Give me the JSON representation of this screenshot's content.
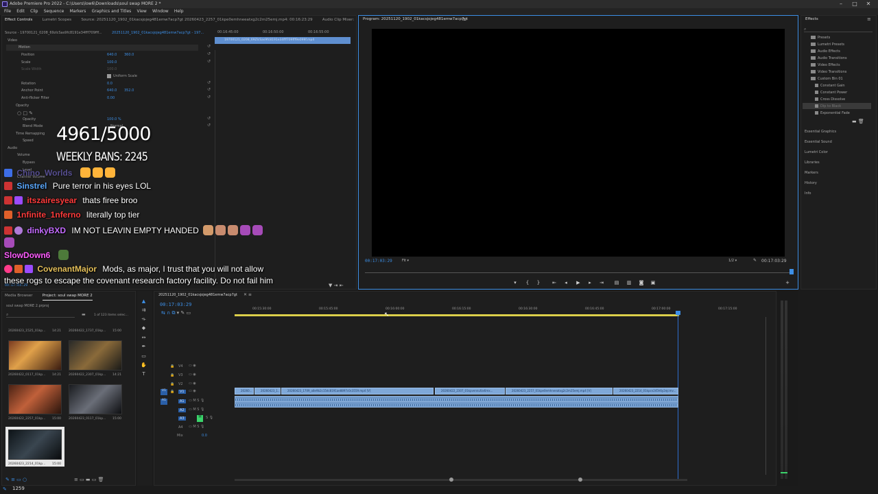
{
  "window": {
    "title": "Adobe Premiere Pro 2022 - C:\\Users\\low6\\Downloads\\soul swap MORE 2 *",
    "controls": [
      "–",
      "□",
      "✕"
    ]
  },
  "menu": [
    "File",
    "Edit",
    "Clip",
    "Sequence",
    "Markers",
    "Graphics and Titles",
    "View",
    "Window",
    "Help"
  ],
  "source_panel": {
    "tabs": [
      "Effect Controls",
      "Lumetri Scopes",
      "Source: 20251120_1902_01kacsjojeg481emw7acp7gt 20260423_2257_01kpe0emhneeatxg2c2m25emj.mp4: 00:16:23:29",
      "Audio Clip Mixer: 2025"
    ],
    "source_path": "Source - 19700121_0208_69zlcSas9fc8191e34fff709fff...",
    "sequence_path": "20251120_1902_01kacsjojeg481emw7acp7gt - 197...",
    "ruler_times": [
      "00:16:45:00",
      "00:16:50:00",
      "00:16:55:00"
    ],
    "clip_label": "19700121_0208_69ZlcSas9fc8191e34fff709fff9e099f.mp4",
    "sections": {
      "video": "Video",
      "motion": "Motion",
      "position": "Position",
      "position_x": "640.0",
      "position_y": "360.0",
      "scale": "Scale",
      "scale_val": "100.0",
      "scale_width": "Scale Width",
      "scale_width_val": "100.0",
      "uniform_scale": "Uniform Scale",
      "rotation": "Rotation",
      "rotation_val": "0.0",
      "anchor": "Anchor Point",
      "anchor_x": "640.0",
      "anchor_y": "352.0",
      "anti_flicker": "Anti-flicker Filter",
      "anti_flicker_val": "0.00",
      "opacity_section": "Opacity",
      "opacity": "Opacity",
      "opacity_val": "100.0 %",
      "blend_mode": "Blend Mode",
      "blend_mode_val": "Normal",
      "time_remap": "Time Remapping",
      "speed": "Speed",
      "audio": "Audio",
      "volume": "Volume",
      "bypass": "Bypass",
      "level": "Level",
      "channel_volume": "Channel Volume"
    },
    "footer_time": "00:17:03:29"
  },
  "overlay": {
    "counter": "4961/5000",
    "weekly_bans": "WEEKLY BANS: 2245",
    "chat": [
      {
        "user": "Chino_Worlds",
        "text": "",
        "user_color": "#8d7cff",
        "emotes": 3
      },
      {
        "user": "Sinstrel",
        "text": "Pure terror in his eyes LOL",
        "user_color": "#5aa8ff",
        "emotes": 0
      },
      {
        "user": "itszairesyear",
        "text": "thats firee broo",
        "user_color": "#ff3b3b",
        "emotes": 0
      },
      {
        "user": "1nfinite_1nferno",
        "text": "literally top tier",
        "user_color": "#ff3b3b",
        "emotes": 0
      },
      {
        "user": "dinkyBXD",
        "text": "IM NOT LEAVIN EMPTY HANDED",
        "user_color": "#c46bff",
        "emotes": 5
      },
      {
        "user": "SlowDown6",
        "text": "",
        "user_color": "#ff5cff",
        "emotes": 1
      },
      {
        "user": "CovenantMajor",
        "text": "Mods, as major, I trust that you will not allow",
        "user_color": "#e6c15a",
        "emotes": 0
      },
      {
        "user": "",
        "text": "these rogs to escape the covenant research factory facility. Do not fail him",
        "user_color": "#ffffff",
        "emotes": 0
      }
    ]
  },
  "program_panel": {
    "title": "Program: 20251120_1902_01kacsjojeg481emw7acp7gt",
    "timecode": "00:17:03:29",
    "fit": "Fit",
    "resolution": "1/2",
    "duration": "00:17:03:29"
  },
  "effects_panel": {
    "title": "Effects",
    "items": [
      {
        "label": "Presets",
        "indent": 0
      },
      {
        "label": "Lumetri Presets",
        "indent": 0
      },
      {
        "label": "Audio Effects",
        "indent": 0
      },
      {
        "label": "Audio Transitions",
        "indent": 0
      },
      {
        "label": "Video Effects",
        "indent": 0
      },
      {
        "label": "Video Transitions",
        "indent": 0
      },
      {
        "label": "Custom Bin 01",
        "indent": 0
      },
      {
        "label": "Constant Gain",
        "indent": 1
      },
      {
        "label": "Constant Power",
        "indent": 1
      },
      {
        "label": "Cross Dissolve",
        "indent": 1
      },
      {
        "label": "Dip to Black",
        "indent": 1
      },
      {
        "label": "Exponential Fade",
        "indent": 1
      }
    ],
    "side": [
      "Essential Graphics",
      "Essential Sound",
      "Lumetri Color",
      "Libraries",
      "Markers",
      "History",
      "Info"
    ]
  },
  "project_panel": {
    "tabs": [
      "Media Browser",
      "Project: soul swap MORE 2"
    ],
    "project_file": "soul swap MORE 2.prproj",
    "count": "1 of 123 items selec...",
    "thumbs": [
      {
        "label": "20260423_1525_01kp...",
        "dur": "14:21"
      },
      {
        "label": "20260422_1737_01kp...",
        "dur": "15:00"
      },
      {
        "label": "20260422_0117_01kp...",
        "dur": "14:21"
      },
      {
        "label": "20260422_2307_01kp...",
        "dur": "14:21"
      },
      {
        "label": "20260422_2257_01kp...",
        "dur": "15:00"
      },
      {
        "label": "20260423_0117_01kp...",
        "dur": "15:00"
      },
      {
        "label": "20260423_2214_01kp...",
        "dur": "15:00"
      }
    ]
  },
  "timeline": {
    "sequence_tab": "20251120_1902_01kacsjojeg481emw7acp7gt",
    "timecode": "00:17:03:29",
    "ruler": [
      "00:15:30:00",
      "00:15:45:00",
      "00:16:00:00",
      "00:16:15:00",
      "00:16:30:00",
      "00:16:45:00",
      "00:17:00:00",
      "00:17:15:00"
    ],
    "video_tracks": [
      "V4",
      "V3",
      "V2",
      "V1"
    ],
    "audio_tracks": [
      "A1",
      "A2",
      "A3",
      "A4"
    ],
    "mix_label": "Mix",
    "mix_value": "0.0",
    "clips_v1": [
      "20260...",
      "20260423_1...",
      "20260423_1709_a8e9b2c15dc8191ae8897c0c3559.mp4 [V]",
      "20260422_2307_01kpvennufzx6mx...",
      "20260423_2257_01kpe0emhneeatxg2c2m25emj.mp4 [V]",
      "20260423_2214_01kpcn245h6y2ejcmv..."
    ]
  },
  "status": {
    "counter": "1259"
  },
  "colors": {
    "accent": "#3d8fe6",
    "clip_video": "#7fa8d8",
    "clip_audio": "#6f98c8",
    "playhead": "#2f6fd0",
    "track_green": "#3bd46b"
  }
}
